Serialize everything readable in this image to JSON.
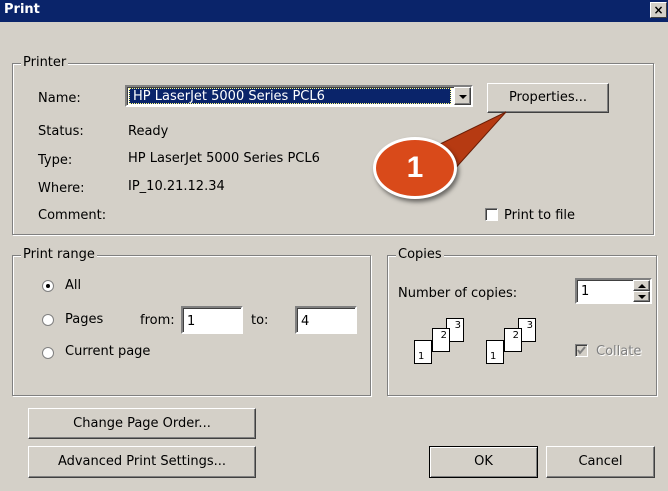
{
  "window": {
    "title": "Print",
    "close_glyph": "×"
  },
  "printer": {
    "group_label": "Printer",
    "name_label": "Name:",
    "name_value": "HP LaserJet 5000 Series PCL6",
    "properties_button": "Properties...",
    "status_label": "Status:",
    "status_value": "Ready",
    "type_label": "Type:",
    "type_value": "HP LaserJet 5000 Series PCL6",
    "where_label": "Where:",
    "where_value": "IP_10.21.12.34",
    "comment_label": "Comment:",
    "print_to_file_label": "Print to file",
    "print_to_file_checked": false
  },
  "callout": {
    "number": "1",
    "color": "#d94a1a"
  },
  "print_range": {
    "group_label": "Print range",
    "options": [
      "All",
      "Pages",
      "Current page"
    ],
    "selected": "All",
    "from_label": "from:",
    "from_value": "1",
    "to_label": "to:",
    "to_value": "4"
  },
  "copies": {
    "group_label": "Copies",
    "number_label": "Number of copies:",
    "number_value": "1",
    "collate_label": "Collate",
    "collate_checked": true,
    "collate_enabled": false,
    "page_labels": [
      "1",
      "2",
      "3"
    ]
  },
  "buttons": {
    "change_page_order": "Change Page Order...",
    "advanced_print_settings": "Advanced Print Settings...",
    "ok": "OK",
    "cancel": "Cancel"
  },
  "colors": {
    "titlebar": "#0a246a",
    "face": "#d4d0c8",
    "selection": "#0a246a"
  }
}
